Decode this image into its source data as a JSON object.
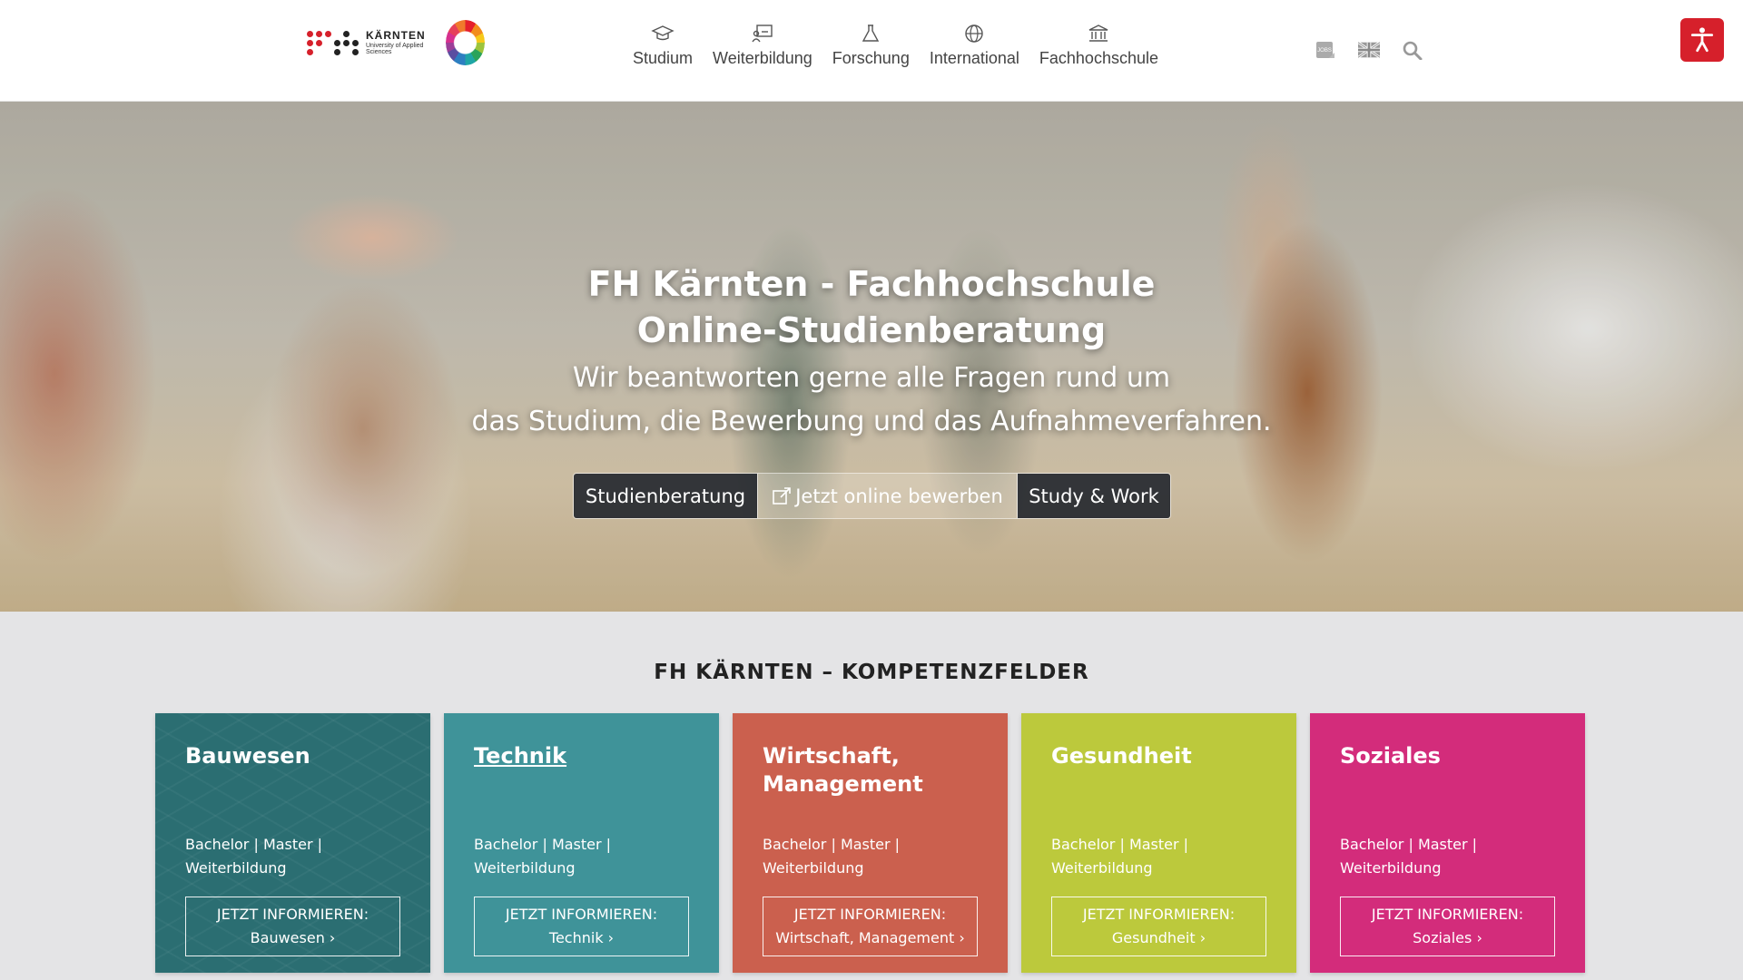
{
  "header": {
    "logo": {
      "brand": "KÄRNTEN",
      "sub": "University of Applied Sciences"
    },
    "nav": [
      {
        "label": "Studium",
        "icon": "graduation-cap-icon"
      },
      {
        "label": "Weiterbildung",
        "icon": "presentation-icon"
      },
      {
        "label": "Forschung",
        "icon": "flask-icon"
      },
      {
        "label": "International",
        "icon": "globe-icon"
      },
      {
        "label": "Fachhochschule",
        "icon": "institution-icon"
      }
    ],
    "tools": {
      "jobs_label": "JOBS",
      "language_icon": "uk-flag-icon",
      "search_icon": "search-icon"
    },
    "accessibility_icon": "accessibility-icon",
    "accent": "#d6202b"
  },
  "hero": {
    "title_line1": "FH Kärnten - Fachhochschule",
    "title_line2": "Online-Studienberatung",
    "sub_line1": "Wir beantworten gerne alle Fragen rund um",
    "sub_line2": "das Studium, die Bewerbung und das Aufnahmeverfahren.",
    "buttons": [
      "Studienberatung",
      "Jetzt online bewerben",
      "Study & Work"
    ]
  },
  "section": {
    "title": "FH KÄRNTEN – KOMPETENZFELDER",
    "cards": [
      {
        "title": "Bauwesen",
        "meta_line1": "Bachelor | Master |",
        "meta_line2": "Weiterbildung",
        "cta_line1": "JETZT INFORMIEREN:",
        "cta_line2": "Bauwesen ›",
        "color": "#2b6e72"
      },
      {
        "title": "Technik",
        "meta_line1": "Bachelor | Master |",
        "meta_line2": "Weiterbildung",
        "cta_line1": "JETZT INFORMIEREN:",
        "cta_line2": "Technik ›",
        "color": "#3f9399"
      },
      {
        "title": "Wirtschaft, Management",
        "meta_line1": "Bachelor | Master |",
        "meta_line2": "Weiterbildung",
        "cta_line1": "JETZT INFORMIEREN:",
        "cta_line2": "Wirtschaft, Management ›",
        "color": "#cb604e"
      },
      {
        "title": "Gesundheit",
        "meta_line1": "Bachelor | Master |",
        "meta_line2": "Weiterbildung",
        "cta_line1": "JETZT INFORMIEREN:",
        "cta_line2": "Gesundheit ›",
        "color": "#bcc93c"
      },
      {
        "title": "Soziales",
        "meta_line1": "Bachelor | Master |",
        "meta_line2": "Weiterbildung",
        "cta_line1": "JETZT INFORMIEREN:",
        "cta_line2": "Soziales ›",
        "color": "#d32c7b"
      }
    ]
  }
}
